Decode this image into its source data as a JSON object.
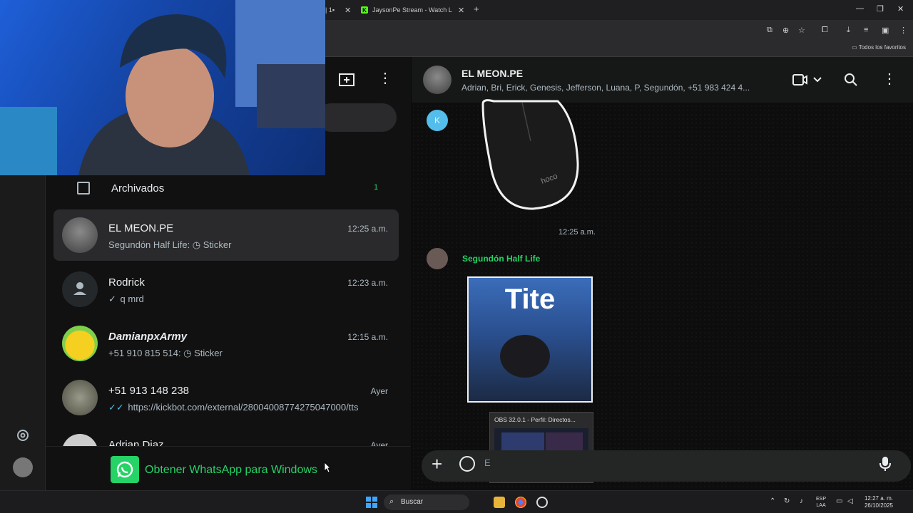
{
  "browser": {
    "prev_tab_label": "| 1▪",
    "active_tab_label": "JaysonPe Stream - Watch Live",
    "bookmarks_label": "Todos los favoritos"
  },
  "whatsapp": {
    "archived": {
      "label": "Archivados",
      "count": "1"
    },
    "chats": [
      {
        "name": "EL MEON.PE",
        "time": "12:25 a.m.",
        "preview": "Segundón Half Life: ◷ Sticker",
        "tick": "",
        "active": true
      },
      {
        "name": "Rodrick",
        "time": "12:23 a.m.",
        "preview": "q mrd",
        "tick": "✓"
      },
      {
        "name": "DamianpxArmy",
        "time": "12:15 a.m.",
        "preview": "+51 910 815 514: ◷ Sticker",
        "tick": ""
      },
      {
        "name": "+51 913 148 238",
        "time": "Ayer",
        "preview": "https://kickbot.com/external/2800400877427504​7000/tts",
        "tick": "✓✓"
      },
      {
        "name": "Adrian Diaz",
        "time": "Ayer",
        "preview": "",
        "tick": ""
      }
    ],
    "get_app_label": "Obtener WhatsApp para Windows",
    "conversation": {
      "name": "EL MEON.PE",
      "members": "Adrian, Bri, Erick, Genesis, Jefferson, Luana, P, Segundón, +51 983 424 4...",
      "k_avatar_letter": "K",
      "sticker_time": "12:25 a.m.",
      "sender_name": "Segundón Half Life",
      "sticker_text": "Tite",
      "input_placeholder": "E"
    },
    "obs_preview_title": "OBS 32.0.1 - Perfil: Directos..."
  },
  "taskbar": {
    "search_label": "Buscar",
    "lang_top": "ESP",
    "lang_bottom": "LAA",
    "clock_time": "12:27 a. m.",
    "clock_date": "26/10/2025"
  },
  "colors": {
    "accent_green": "#25d366",
    "read_tick": "#53bdeb"
  }
}
